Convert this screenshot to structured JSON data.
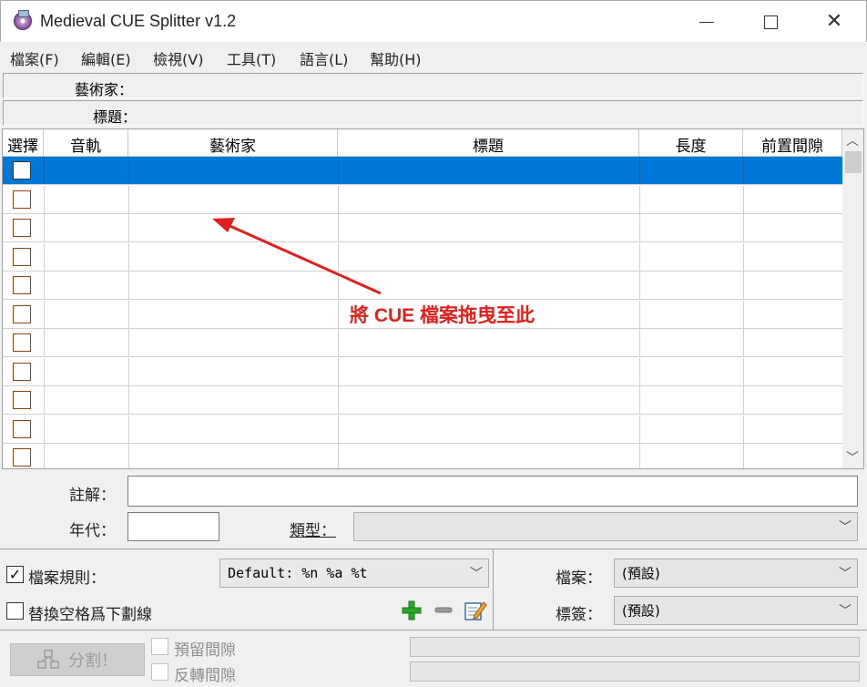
{
  "window": {
    "title": "Medieval CUE Splitter v1.2",
    "minimize": "",
    "maximize": "",
    "close": "✕"
  },
  "menu": [
    "檔案(F)",
    "編輯(E)",
    "檢視(V)",
    "工具(T)",
    "語言(L)",
    "幫助(H)"
  ],
  "header": {
    "artist_label": "藝術家：",
    "title_label": "標題："
  },
  "table": {
    "columns": [
      "選擇",
      "音軌",
      "藝術家",
      "標題",
      "長度",
      "前置間隙"
    ],
    "row_count": 11,
    "selected_row": 0
  },
  "annotation": {
    "text": "將 CUE 檔案拖曳至此",
    "color": "#e0201e"
  },
  "fields": {
    "comment_label": "註解：",
    "comment_value": "",
    "year_label": "年代：",
    "year_value": "",
    "genre_label": "類型：",
    "genre_value": ""
  },
  "options": {
    "filename_rule_label": "檔案規則：",
    "filename_rule_checked": true,
    "filename_rule_value": "Default: %n %a %t",
    "replace_spaces_label": "替換空格爲下劃線",
    "replace_spaces_checked": false,
    "file_label": "檔案：",
    "file_value": "(預設)",
    "tag_label": "標簽：",
    "tag_value": "(預設)"
  },
  "footer": {
    "split_label": "分割！",
    "keep_gap_label": "預留間隙",
    "reverse_gap_label": "反轉間隙"
  },
  "colors": {
    "selection": "#0078d7",
    "annotation": "#e0201e",
    "plus": "#2aa52a"
  }
}
